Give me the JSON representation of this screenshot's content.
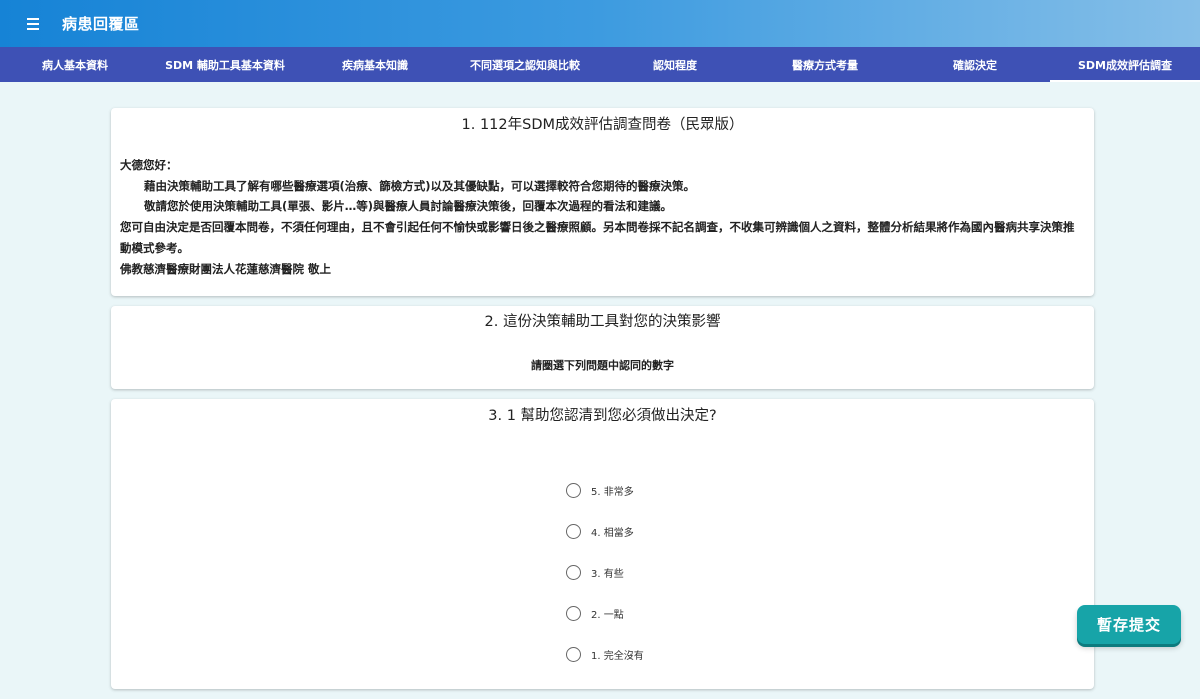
{
  "header": {
    "menu_icon": "hamburger-menu-icon",
    "title": "病患回覆區"
  },
  "nav": {
    "tabs": [
      {
        "label": "病人基本資料"
      },
      {
        "label": "SDM 輔助工具基本資料"
      },
      {
        "label": "疾病基本知識"
      },
      {
        "label": "不同選項之認知與比較"
      },
      {
        "label": "認知程度"
      },
      {
        "label": "醫療方式考量"
      },
      {
        "label": "確認決定"
      },
      {
        "label": "SDM成效評估調查"
      }
    ],
    "active_index": 7
  },
  "section1": {
    "title": "1. 112年SDM成效評估調查問卷（民眾版）",
    "greeting": "大德您好：",
    "line1": "藉由決策輔助工具了解有哪些醫療選項(治療、篩檢方式)以及其優缺點，可以選擇較符合您期待的醫療決策。",
    "line2": "敬請您於使用決策輔助工具(單張、影片…等)與醫療人員討論醫療決策後，回覆本次過程的看法和建議。",
    "line3": "您可自由決定是否回覆本問卷，不須任何理由，且不會引起任何不愉快或影響日後之醫療照顧。另本問卷採不記名調查，不收集可辨識個人之資料，整體分析結果將作為國內醫病共享決策推動模式參考。",
    "signature": "佛教慈濟醫療財團法人花蓮慈濟醫院 敬上"
  },
  "section2": {
    "title": "2. 這份決策輔助工具對您的決策影響",
    "instruction": "請圈選下列問題中認同的數字"
  },
  "section3": {
    "title": "3. 1 幫助您認清到您必須做出決定?",
    "options": [
      {
        "label": "5. 非常多"
      },
      {
        "label": "4. 相當多"
      },
      {
        "label": "3. 有些"
      },
      {
        "label": "2. 一點"
      },
      {
        "label": "1. 完全沒有"
      }
    ]
  },
  "save_button": {
    "label": "暫存提交",
    "color": "#17a4a8"
  },
  "colors": {
    "header_start": "#1683d6",
    "nav_bg": "#3e51b5",
    "page_bg": "#eaf6f8"
  }
}
